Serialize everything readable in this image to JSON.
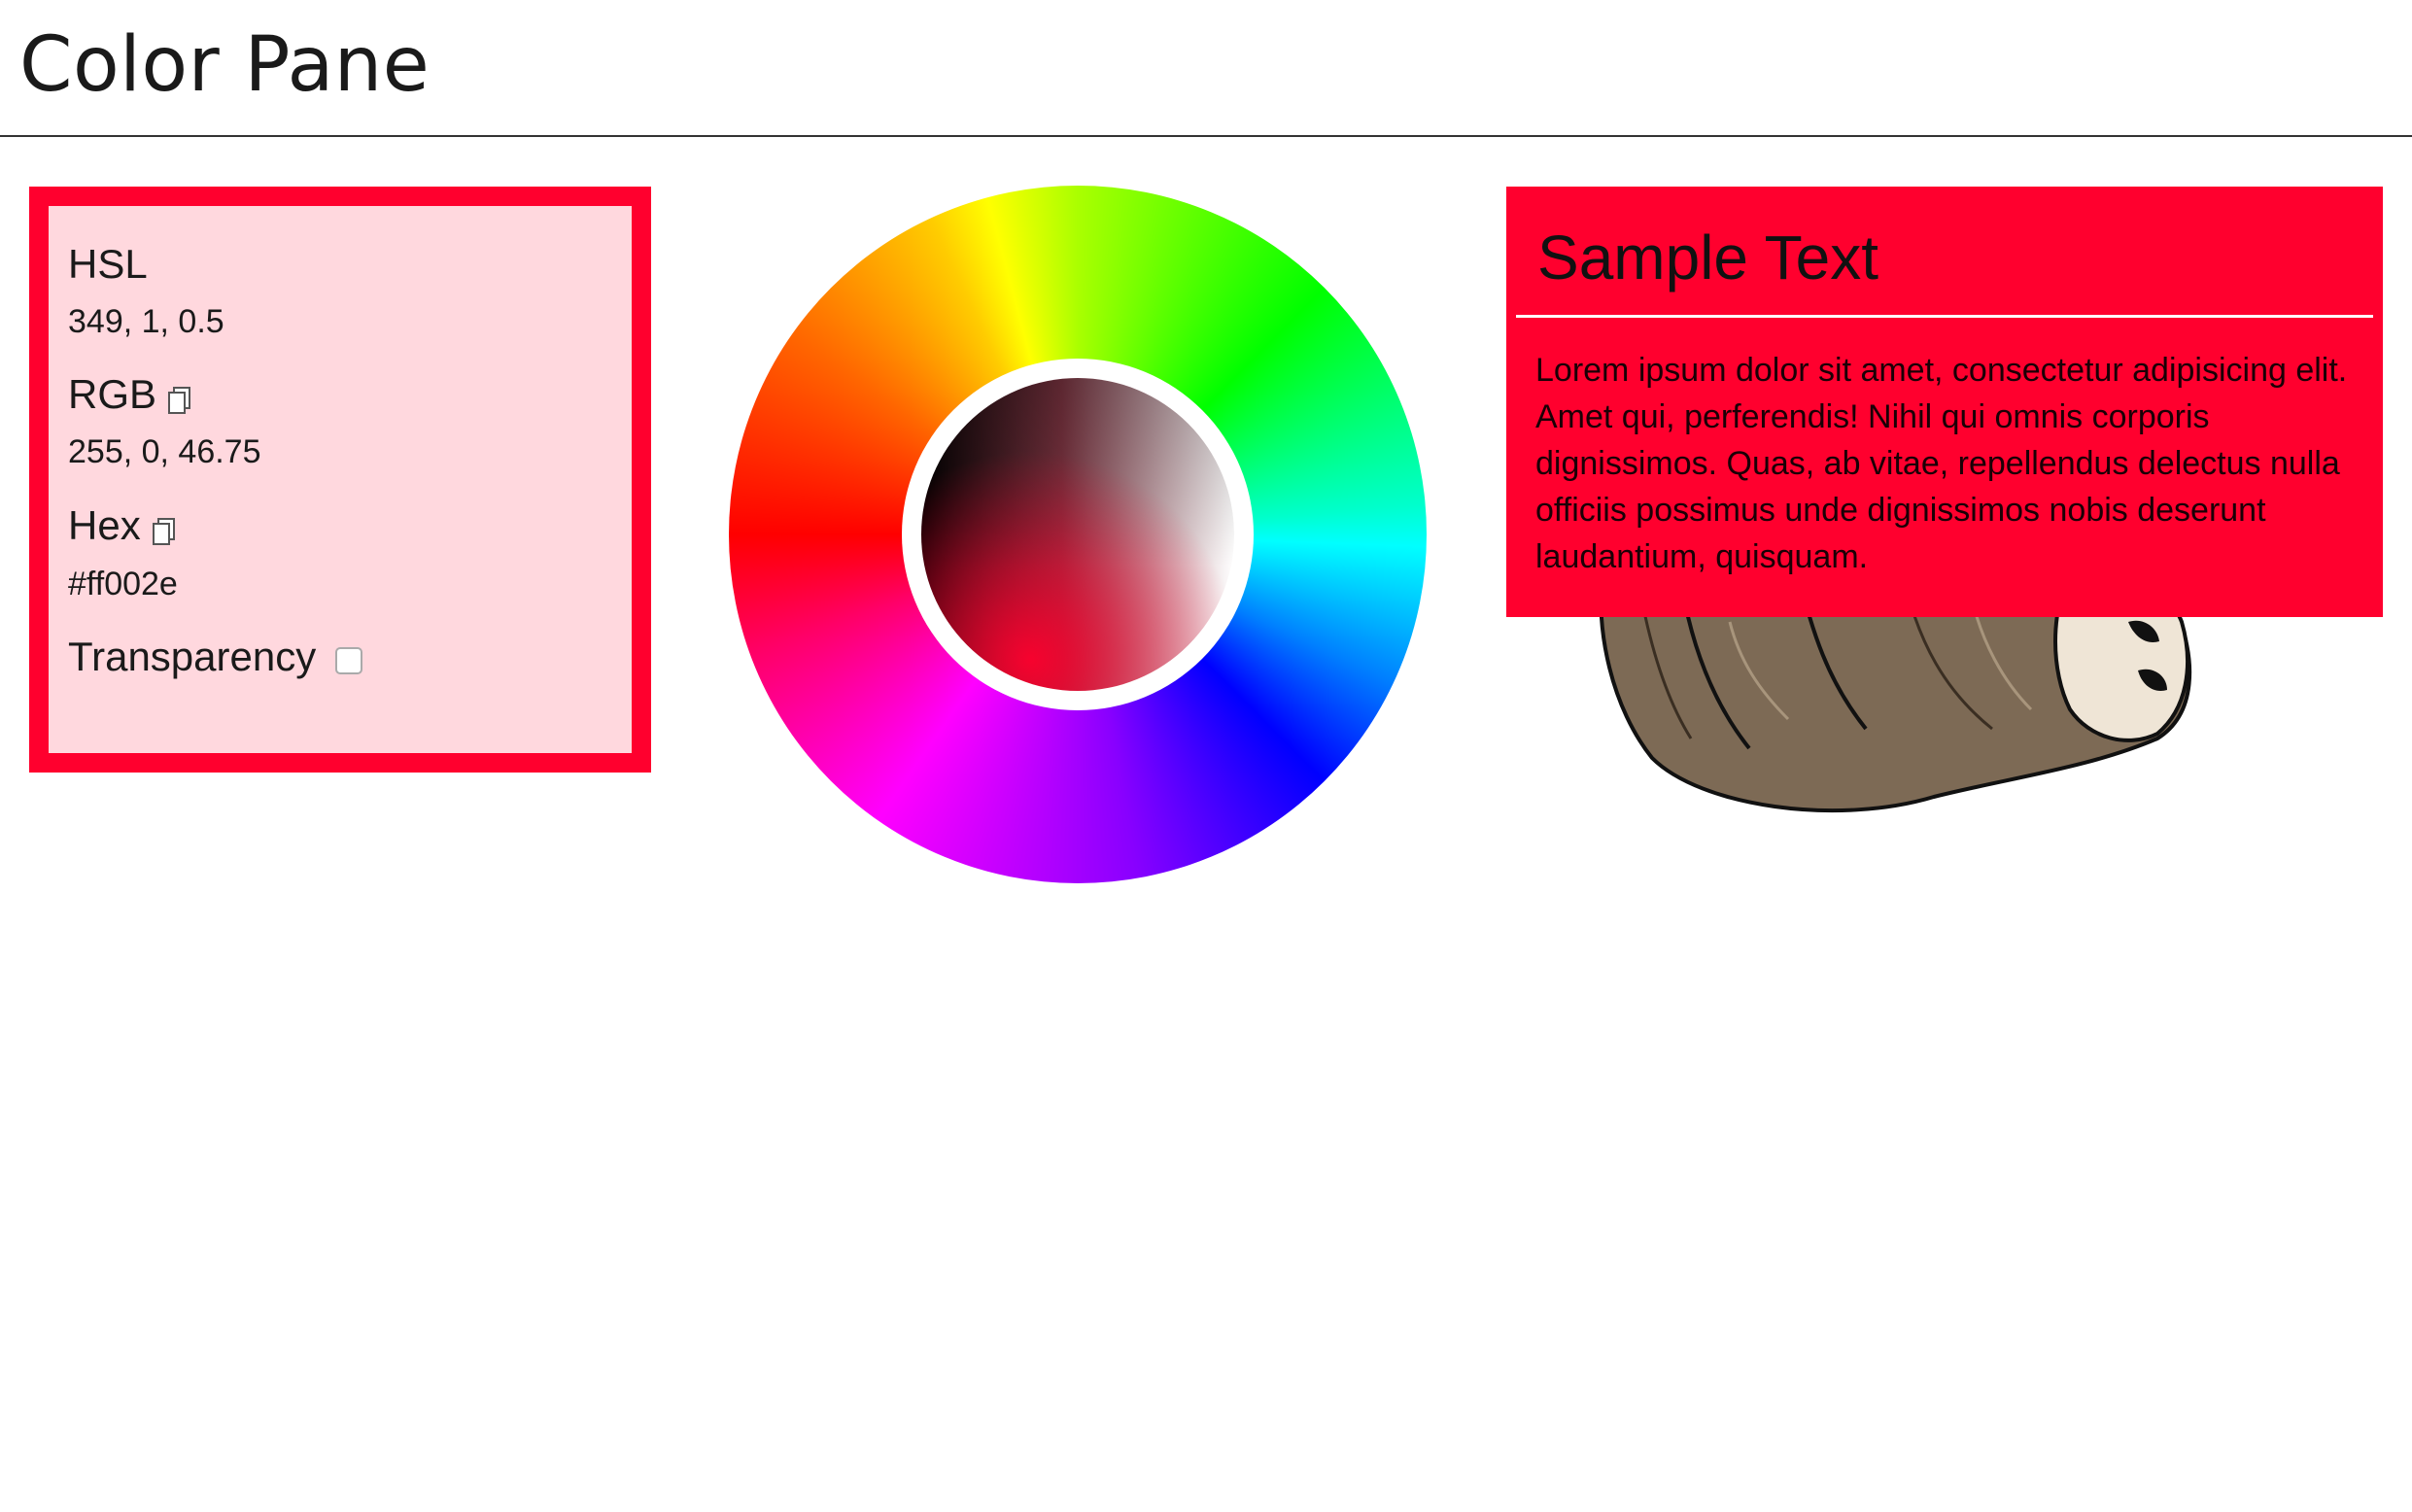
{
  "header": {
    "title": "Color Pane"
  },
  "info": {
    "hsl_label": "HSL",
    "hsl_value": "349, 1, 0.5",
    "rgb_label": "RGB",
    "rgb_value": "255, 0, 46.75",
    "hex_label": "Hex",
    "hex_value": "#ff002e",
    "transparency_label": "Transparency",
    "copy_icon": "copy-icon"
  },
  "colors": {
    "selected": "#ff002e",
    "panel_background": "#ffd8de"
  },
  "sample": {
    "heading": "Sample Text",
    "body": "Lorem ipsum dolor sit amet, consectetur adipisicing elit. Amet qui, perferendis! Nihil qui omnis corporis dignissimos. Quas, ab vitae, repellendus delectus nulla officiis possimus unde dignissimos nobis deserunt laudantium, quisquam."
  }
}
